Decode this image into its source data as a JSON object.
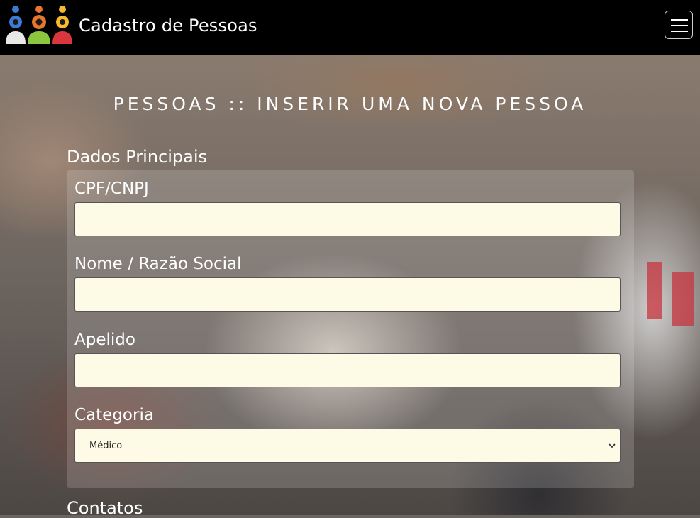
{
  "navbar": {
    "brand": "Cadastro de Pessoas",
    "logo_alt": "people-logo",
    "menu_icon": "hamburger-icon"
  },
  "page": {
    "title": "PESSOAS :: INSERIR UMA NOVA PESSOA"
  },
  "sections": {
    "main": "Dados Principais",
    "contacts": "Contatos"
  },
  "form": {
    "cpf_label": "CPF/CNPJ",
    "cpf_value": "",
    "nome_label": "Nome / Razão Social",
    "nome_value": "",
    "apelido_label": "Apelido",
    "apelido_value": "",
    "categoria_label": "Categoria",
    "categoria_selected": "Médico"
  },
  "colors": {
    "navbar_bg": "#000000",
    "input_bg": "#fdfbe6",
    "text": "#ffffff",
    "logo_blue": "#3b7bd4",
    "logo_orange": "#e8762c",
    "logo_green": "#8cc63f",
    "logo_red": "#d9363e",
    "logo_yellow": "#f5b82e"
  }
}
